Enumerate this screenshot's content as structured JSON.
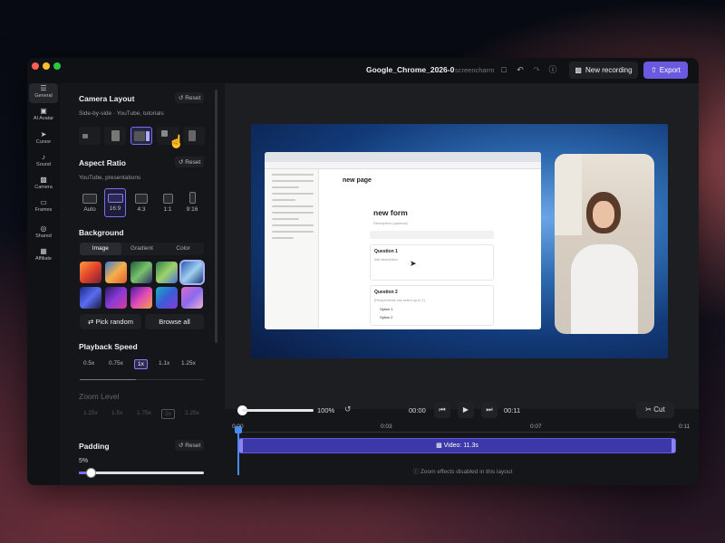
{
  "titlebar": {
    "file_title": "Google_Chrome_2026-0",
    "app_name": "screencharm",
    "new_recording_label": "New recording",
    "export_label": "Export"
  },
  "iconbar": {
    "items": [
      {
        "label": "General",
        "icon": "sliders-icon"
      },
      {
        "label": "AI Avatar",
        "icon": "robot-icon"
      },
      {
        "label": "Cursor",
        "icon": "cursor-icon"
      },
      {
        "label": "Sound",
        "icon": "speaker-icon"
      },
      {
        "label": "Camera",
        "icon": "camera-icon"
      },
      {
        "label": "Frames",
        "icon": "monitor-icon"
      },
      {
        "label": "Shared",
        "icon": "globe-icon"
      },
      {
        "label": "Affiliate",
        "icon": "gift-icon"
      }
    ]
  },
  "panel": {
    "camera_layout": {
      "title": "Camera Layout",
      "reset": "Reset",
      "subtitle": "Side-by-side · YouTube, tutorials"
    },
    "aspect_ratio": {
      "title": "Aspect Ratio",
      "reset": "Reset",
      "subtitle": "YouTube, presentations",
      "options": [
        "Auto",
        "16:9",
        "4:3",
        "1:1",
        "9:16"
      ],
      "selected": "16:9"
    },
    "background": {
      "title": "Background",
      "tabs": [
        "Image",
        "Gradient",
        "Color"
      ],
      "selected_tab": "Image",
      "pick_random": "Pick random",
      "browse_all": "Browse all"
    },
    "playback_speed": {
      "title": "Playback Speed",
      "options": [
        "0.5x",
        "0.75x",
        "1x",
        "1.1x",
        "1.25x"
      ],
      "selected": "1x"
    },
    "zoom_level": {
      "title": "Zoom Level",
      "options": [
        "1.25x",
        "1.5x",
        "1.75x",
        "2x",
        "2.25x"
      ],
      "selected": "2x"
    },
    "padding": {
      "title": "Padding",
      "reset": "Reset",
      "value": "5%",
      "fraction": 0.05
    }
  },
  "preview": {
    "browser": {
      "page_title": "new page",
      "form_title": "new form",
      "form_description": "Description (optional)",
      "question1": "Question 1",
      "question1_hint": "Ask description",
      "question2": "Question 2",
      "question2_hint": "(Respondents can select up to 1)",
      "option1": "Option 1",
      "option2": "Option 2"
    }
  },
  "playback": {
    "zoom": "100%",
    "current_time": "00:00",
    "end_time": "00:11",
    "cut_label": "Cut",
    "progress": 0.0
  },
  "timeline": {
    "ticks": [
      "0:00",
      "0:03",
      "0:07",
      "0:11"
    ],
    "track_label": "Video: 11.3s",
    "note": "Zoom effects disabled in this layout"
  }
}
